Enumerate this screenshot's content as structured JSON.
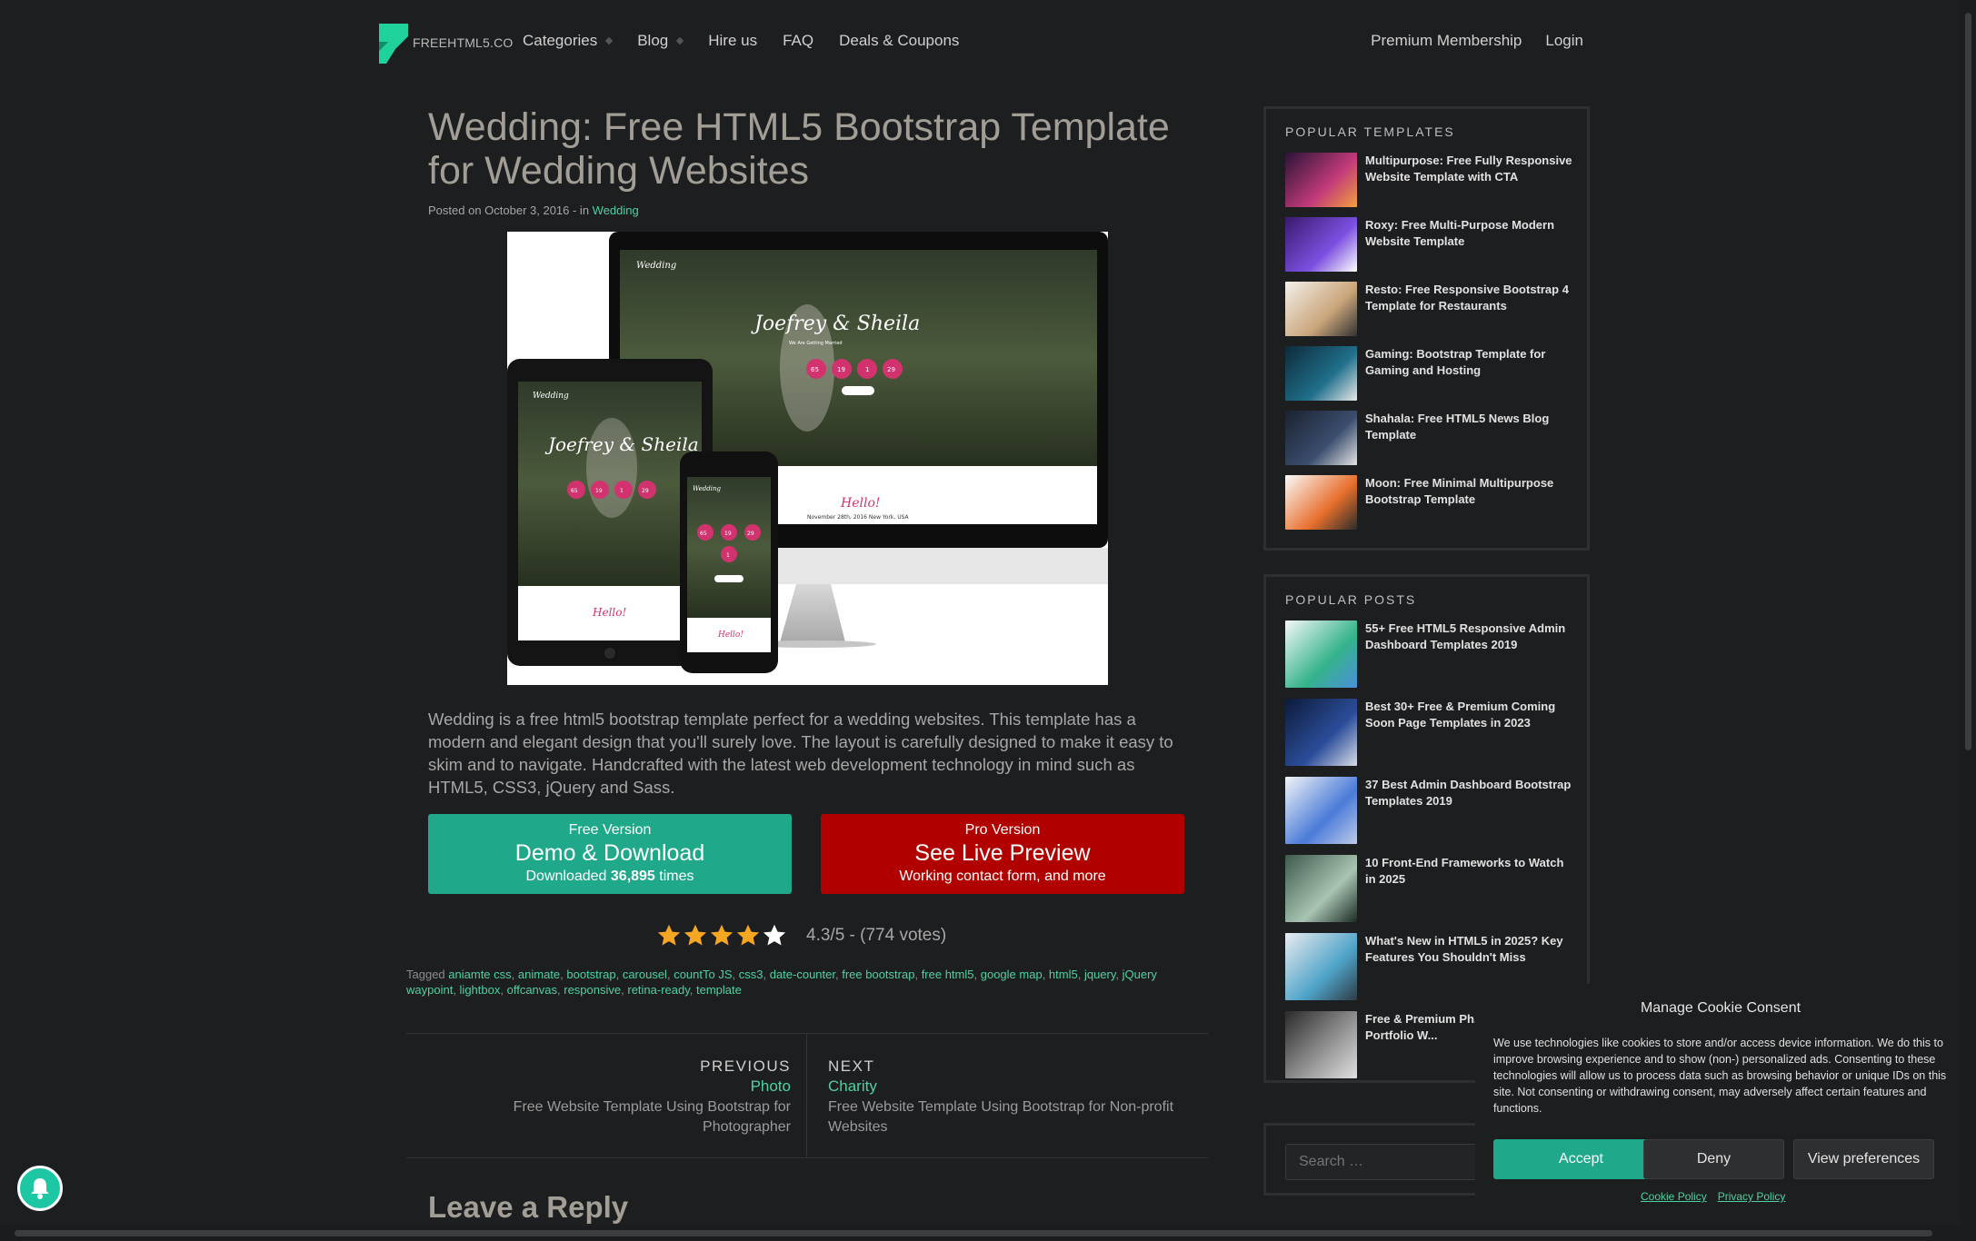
{
  "header": {
    "logo_text": "FREEHTML5.CO",
    "nav": [
      "Categories",
      "Blog",
      "Hire us",
      "FAQ",
      "Deals & Coupons"
    ],
    "nav_right": [
      "Premium Membership",
      "Login"
    ]
  },
  "post": {
    "title": "Wedding: Free HTML5 Bootstrap Template for Wedding Websites",
    "meta_prefix": "Posted on October 3, 2016 - in ",
    "category": "Wedding",
    "description": "Wedding is a free html5 bootstrap template perfect for a wedding websites. This template has a modern and elegant design that you'll surely love. The layout is carefully designed to make it easy to skim and to navigate. Handcrafted with the latest web development technology in mind such as HTML5, CSS3, jQuery and Sass.",
    "hero": {
      "brand": "Wedding",
      "names": "Joefrey & Sheila",
      "subtitle": "We Are Getting Married",
      "counters": [
        "65",
        "19",
        "1",
        "29"
      ],
      "hello": "Hello!",
      "date_line": "November 28th, 2016 New York, USA"
    },
    "free_button": {
      "small": "Free Version",
      "big": "Demo & Download",
      "sub_prefix": "Downloaded ",
      "count": "36,895",
      "sub_suffix": " times"
    },
    "pro_button": {
      "small": "Pro Version",
      "big": "See Live Preview",
      "sub": "Working contact form, and more"
    },
    "rating": {
      "stars": 4.3,
      "text": "4.3/5 - (774 votes)"
    },
    "tags_label": "Tagged",
    "tags": [
      "aniamte css",
      "animate",
      "bootstrap",
      "carousel",
      "countTo JS",
      "css3",
      "date-counter",
      "free bootstrap",
      "free html5",
      "google map",
      "html5",
      "jquery",
      "jQuery waypoint",
      "lightbox",
      "offcanvas",
      "responsive",
      "retina-ready",
      "template"
    ],
    "prev": {
      "label": "PREVIOUS",
      "title": "Photo",
      "desc": "Free Website Template Using Bootstrap for Photographer"
    },
    "next": {
      "label": "NEXT",
      "title": "Charity",
      "desc": "Free Website Template Using Bootstrap for Non-profit Websites"
    },
    "reply_heading": "Leave a Reply"
  },
  "sidebar": {
    "popular_templates": {
      "title": "POPULAR TEMPLATES",
      "items": [
        {
          "title": "Multipurpose: Free Fully Responsive Website Template with CTA"
        },
        {
          "title": "Roxy: Free Multi-Purpose Modern Website Template"
        },
        {
          "title": "Resto: Free Responsive Bootstrap 4 Template for Restaurants"
        },
        {
          "title": "Gaming: Bootstrap Template for Gaming and Hosting"
        },
        {
          "title": "Shahala: Free HTML5 News Blog Template"
        },
        {
          "title": "Moon: Free Minimal Multipurpose Bootstrap Template"
        }
      ]
    },
    "popular_posts": {
      "title": "POPULAR POSTS",
      "items": [
        {
          "title": "55+ Free HTML5 Responsive Admin Dashboard Templates 2019"
        },
        {
          "title": "Best 30+ Free & Premium Coming Soon Page Templates in 2023"
        },
        {
          "title": "37 Best Admin Dashboard Bootstrap Templates 2019"
        },
        {
          "title": "10 Front-End Frameworks to Watch in 2025"
        },
        {
          "title": "What's New in HTML5 in 2025? Key Features You Shouldn't Miss"
        },
        {
          "title": "Free & Premium Ph... Creative Portfolio W..."
        }
      ]
    },
    "search_placeholder": "Search …"
  },
  "cookie": {
    "title": "Manage Cookie Consent",
    "body": "We use technologies like cookies to store and/or access device information. We do this to improve browsing experience and to show (non-) personalized ads. Consenting to these technologies will allow us to process data such as browsing behavior or unique IDs on this site. Not consenting or withdrawing consent, may adversely affect certain features and functions.",
    "accept": "Accept",
    "deny": "Deny",
    "preferences": "View preferences",
    "links": [
      "Cookie Policy",
      "Privacy Policy"
    ]
  },
  "colors": {
    "background": "#1d1e20",
    "accent": "#1fa88a",
    "link": "#4ed1a1",
    "pro": "#b00000",
    "star": "#f5a623"
  }
}
